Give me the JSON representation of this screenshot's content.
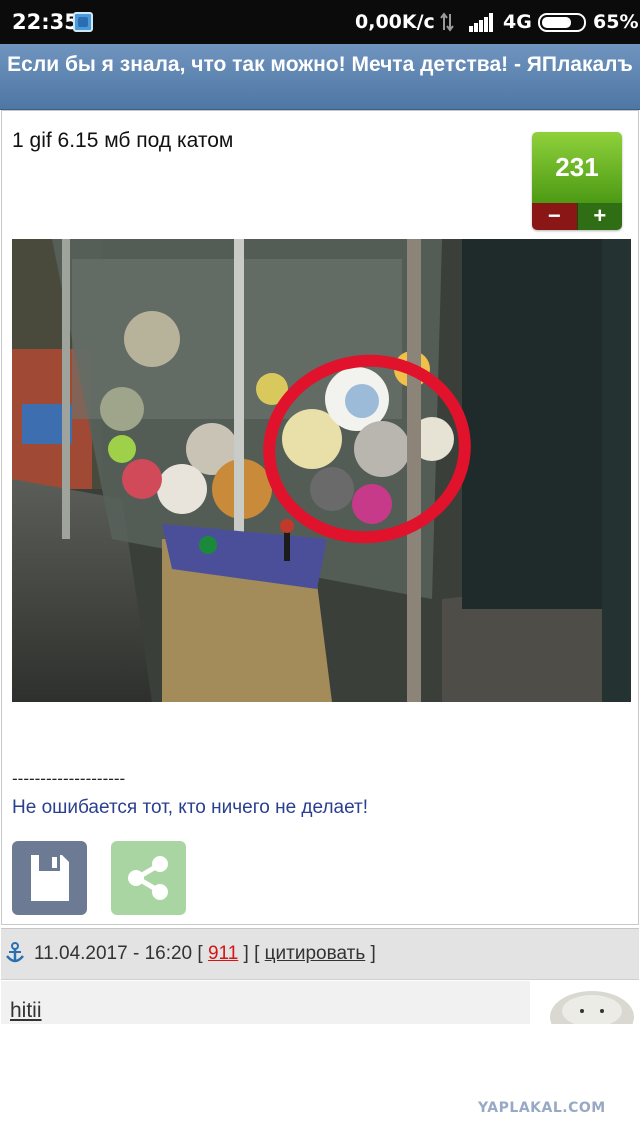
{
  "status_bar": {
    "time": "22:35",
    "speed": "0,00K/c",
    "network": "4G",
    "battery_percent": "65%",
    "icons": [
      "app-notification-icon",
      "sync-icon",
      "signal-icon",
      "battery-icon"
    ]
  },
  "header": {
    "title": "Если бы я знала, что так можно! Мечта детства! - ЯПлакалъ"
  },
  "post": {
    "description": "1 gif 6.15 мб под катом",
    "rating": {
      "score": "231",
      "minus_label": "−",
      "plus_label": "+",
      "score_color": "#6bb526",
      "minus_color": "#8a1616",
      "plus_color": "#2f6e14"
    },
    "separator": "--------------------",
    "signature": "Не ошибается тот, кто ничего не делает!",
    "actions": {
      "save_icon": "floppy-disk-icon",
      "share_icon": "share-icon",
      "save_color": "#6d7a93",
      "share_color": "#a9d5a2"
    }
  },
  "comment": {
    "anchor_icon": "anchor-icon",
    "date": "11.04.2017 - 16:20",
    "count": "911",
    "quote_label": "цитировать",
    "username": "hitii"
  },
  "watermark": "YAPLAKAL.COM",
  "colors": {
    "header_bg": "#5a80ad",
    "link_blue": "#2a3f8f",
    "count_red": "#d41515"
  }
}
